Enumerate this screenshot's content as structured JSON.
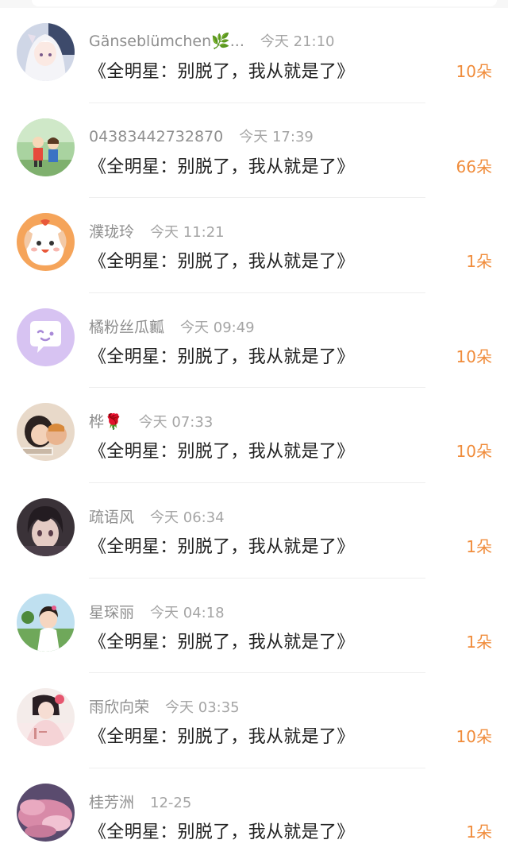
{
  "colors": {
    "count_accent": "#f08c3b",
    "name_gray": "#8f8f8f",
    "message_text": "#222222"
  },
  "rows": [
    {
      "name": "Gänseblümchen🌿...",
      "time": "今天 21:10",
      "message": "《全明星：别脱了，我从就是了》",
      "count": "10朵",
      "avatar": "anime-girl-avatar"
    },
    {
      "name": "04383442732870",
      "time": "今天 17:39",
      "message": "《全明星：别脱了，我从就是了》",
      "count": "66朵",
      "avatar": "cartoon-kids-avatar"
    },
    {
      "name": "濮珑玲",
      "time": "今天 11:21",
      "message": "《全明星：别脱了，我从就是了》",
      "count": "1朵",
      "avatar": "white-dog-avatar"
    },
    {
      "name": "橘粉丝瓜瓤",
      "time": "今天 09:49",
      "message": "《全明星：别脱了，我从就是了》",
      "count": "10朵",
      "avatar": "chat-bubble-avatar"
    },
    {
      "name": "桦🌹",
      "time": "今天 07:33",
      "message": "《全明星：别脱了，我从就是了》",
      "count": "10朵",
      "avatar": "baby-photo-avatar"
    },
    {
      "name": "疏语风",
      "time": "今天 06:34",
      "message": "《全明星：别脱了，我从就是了》",
      "count": "1朵",
      "avatar": "anime-dark-hair-avatar"
    },
    {
      "name": "星琛丽",
      "time": "今天 04:18",
      "message": "《全明星：别脱了，我从就是了》",
      "count": "1朵",
      "avatar": "girl-photo-avatar"
    },
    {
      "name": "雨欣向荣",
      "time": "今天 03:35",
      "message": "《全明星：别脱了，我从就是了》",
      "count": "10朵",
      "avatar": "ancient-style-avatar"
    },
    {
      "name": "桂芳洲",
      "time": "12-25",
      "message": "《全明星：别脱了，我从就是了》",
      "count": "1朵",
      "avatar": "pink-sky-avatar"
    }
  ]
}
